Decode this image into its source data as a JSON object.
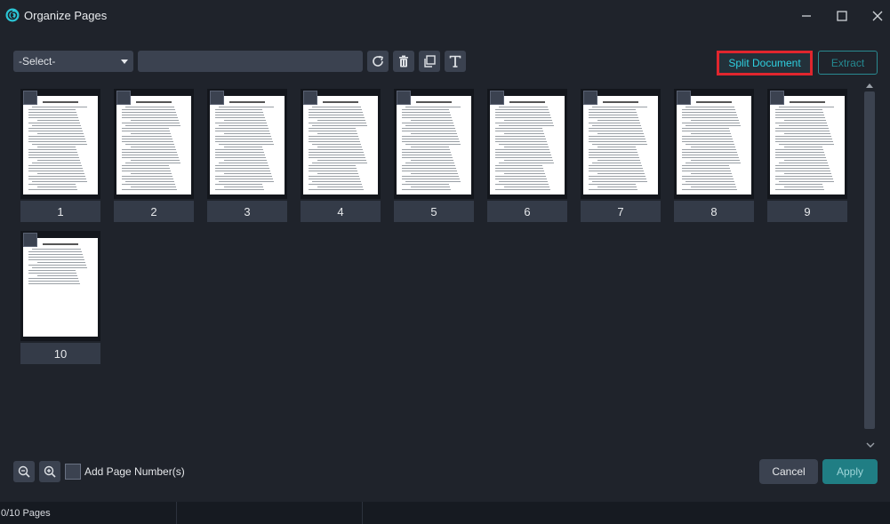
{
  "window": {
    "title": "Organize Pages",
    "icons": {
      "logo": "app-swirl-icon",
      "minimize": "minimize-icon",
      "maximize": "maximize-icon",
      "close": "close-icon"
    }
  },
  "toolbar": {
    "select_value": "-Select-",
    "range_input_value": "",
    "tools": [
      "rotate-icon",
      "trash-icon",
      "duplicate-icon",
      "text-icon"
    ],
    "split_label": "Split Document",
    "extract_label": "Extract"
  },
  "pages": [
    {
      "label": "1"
    },
    {
      "label": "2"
    },
    {
      "label": "3"
    },
    {
      "label": "4"
    },
    {
      "label": "5"
    },
    {
      "label": "6"
    },
    {
      "label": "7"
    },
    {
      "label": "8"
    },
    {
      "label": "9"
    },
    {
      "label": "10"
    }
  ],
  "footer": {
    "add_page_numbers_label": "Add Page Number(s)",
    "cancel_label": "Cancel",
    "apply_label": "Apply"
  },
  "status": {
    "pages_text": "0/10 Pages"
  },
  "colors": {
    "background": "#1f232b",
    "accent": "#207e84",
    "highlight_border": "#e0262e",
    "split_text": "#2fd0e0"
  }
}
